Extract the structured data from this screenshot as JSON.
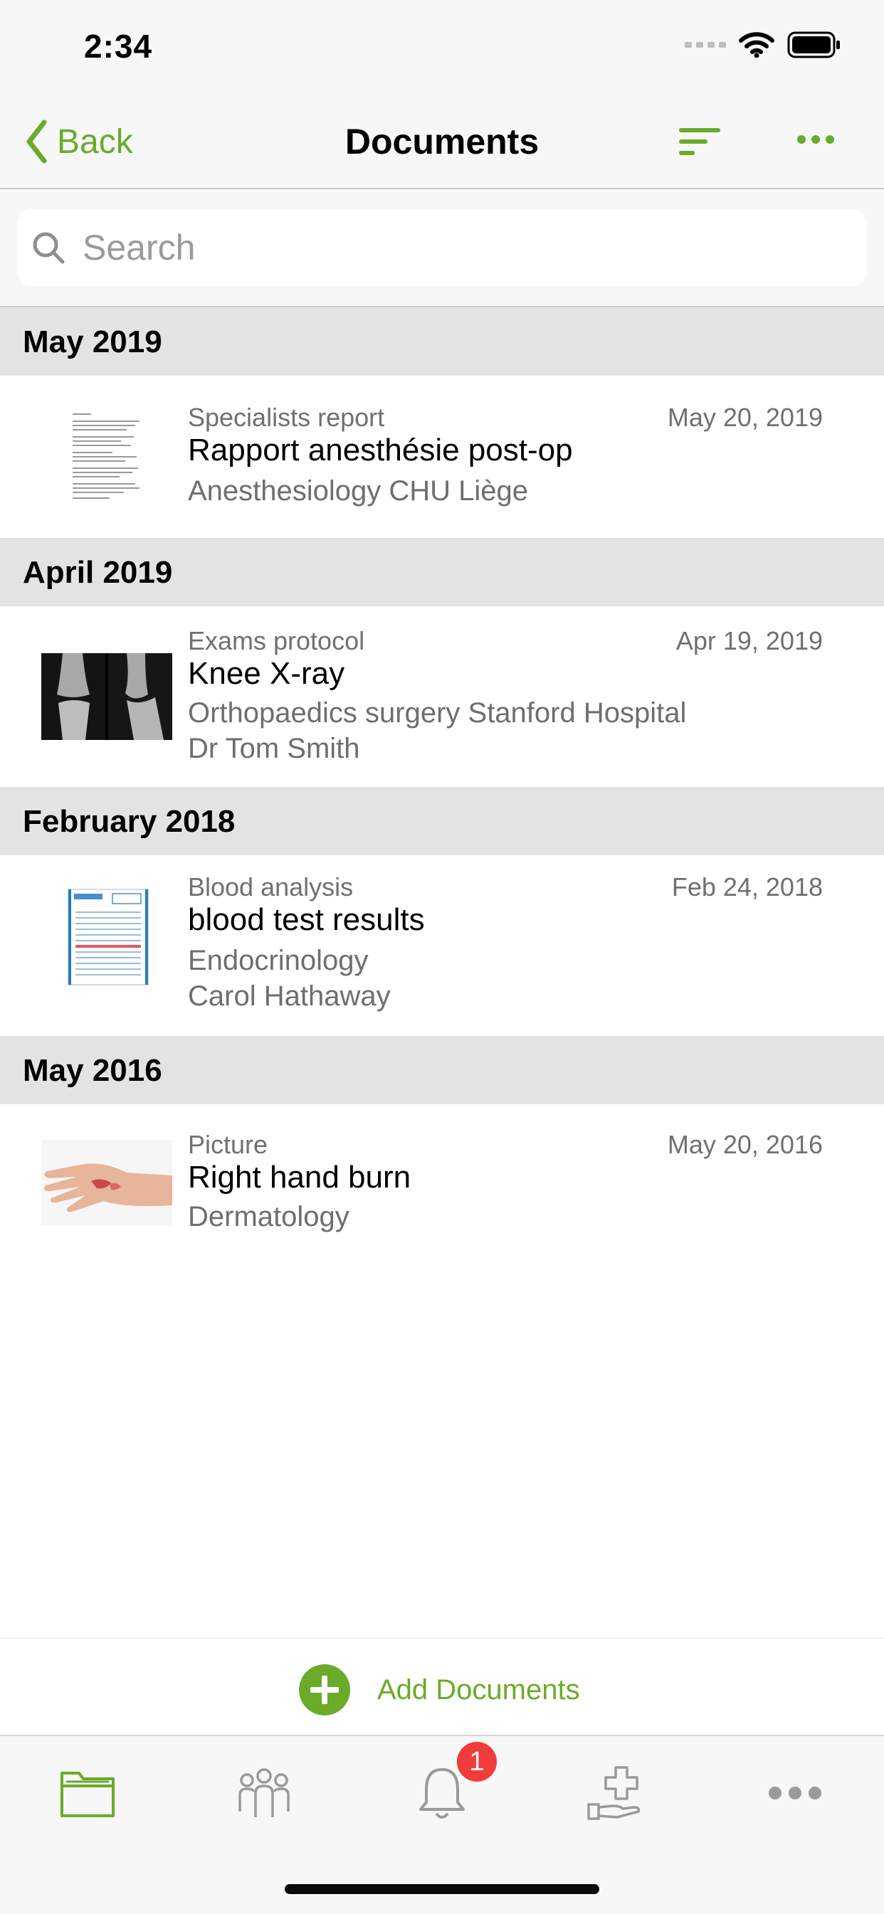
{
  "status": {
    "time": "2:34"
  },
  "nav": {
    "back_label": "Back",
    "title": "Documents"
  },
  "search": {
    "placeholder": "Search"
  },
  "sections": [
    {
      "heading": "May 2019",
      "items": [
        {
          "category": "Specialists report",
          "date": "May 20, 2019",
          "title": "Rapport anesthésie post-op",
          "lines": [
            "Anesthesiology CHU Liège"
          ]
        }
      ]
    },
    {
      "heading": "April 2019",
      "items": [
        {
          "category": "Exams protocol",
          "date": "Apr 19, 2019",
          "title": "Knee X-ray",
          "lines": [
            "Orthopaedics surgery Stanford Hospital",
            "Dr Tom Smith"
          ]
        }
      ]
    },
    {
      "heading": "February 2018",
      "items": [
        {
          "category": "Blood analysis",
          "date": "Feb 24, 2018",
          "title": "blood test results",
          "lines": [
            "Endocrinology",
            "Carol Hathaway"
          ]
        }
      ]
    },
    {
      "heading": "May 2016",
      "items": [
        {
          "category": "Picture",
          "date": "May 20, 2016",
          "title": "Right hand burn",
          "lines": [
            "Dermatology"
          ]
        }
      ]
    }
  ],
  "add": {
    "label": "Add Documents"
  },
  "tabbar": {
    "tabs": [
      "folder-icon",
      "people-icon",
      "bell-icon",
      "medical-care-icon",
      "more-icon"
    ],
    "notification_badge": "1"
  },
  "colors": {
    "accent": "#6aab2a",
    "badge": "#f23b3b",
    "section_bg": "#e3e3e3"
  }
}
